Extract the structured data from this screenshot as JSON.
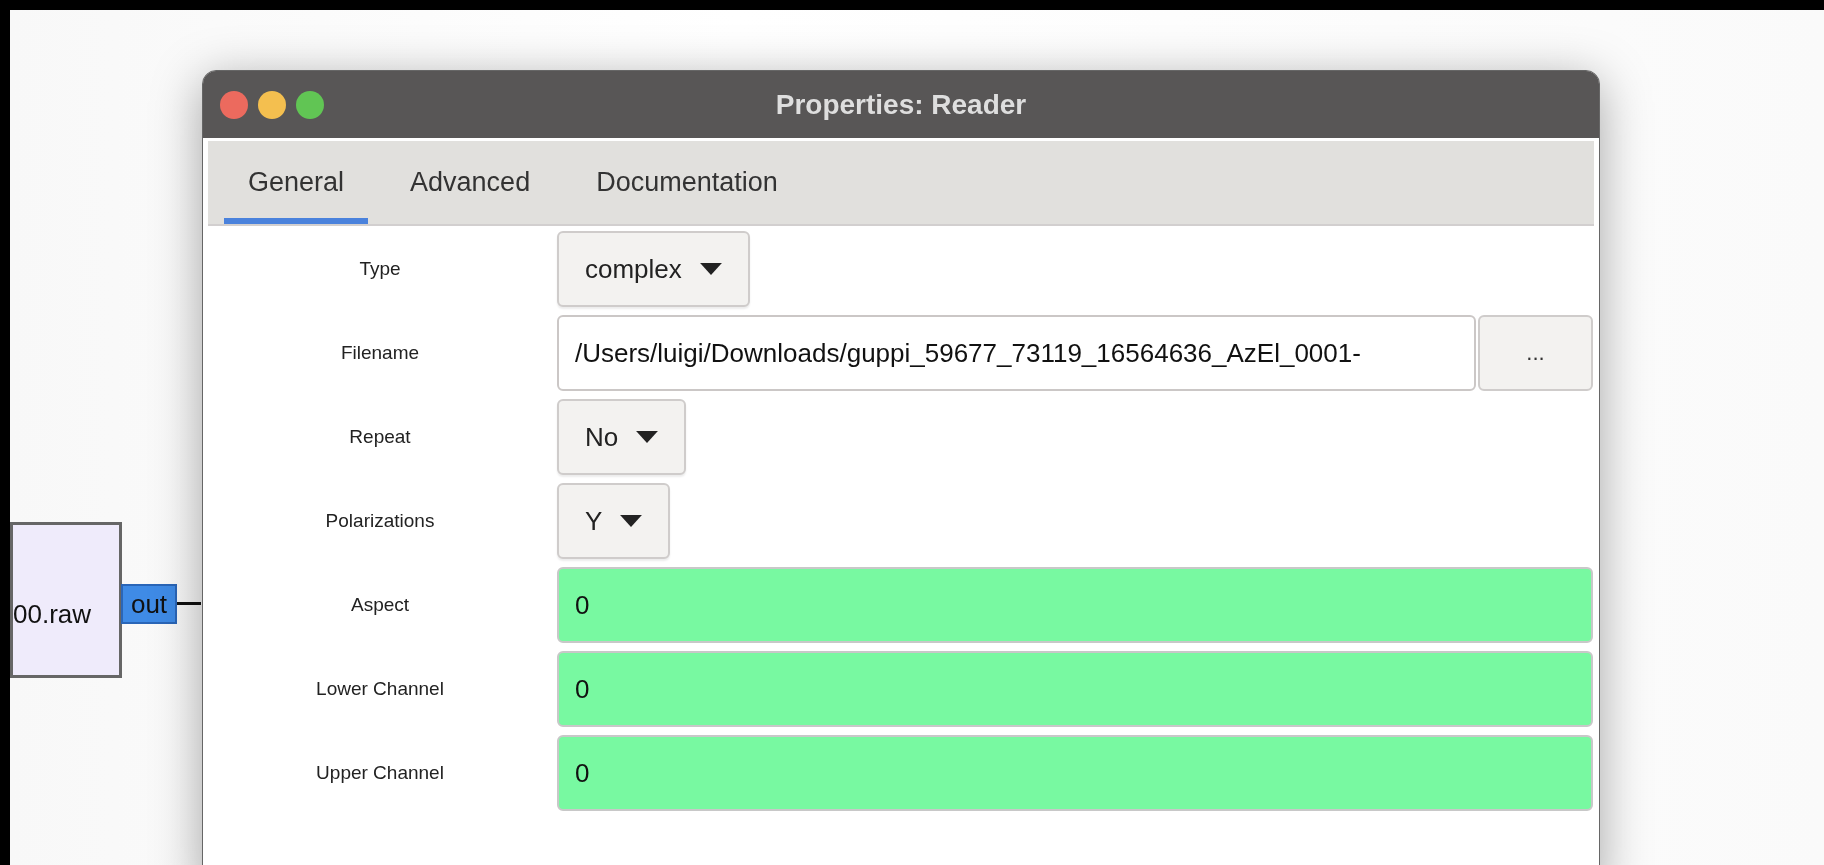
{
  "canvas": {
    "block": {
      "label": "00.raw",
      "port": "out"
    }
  },
  "window": {
    "title": "Properties: Reader"
  },
  "tabs": [
    {
      "label": "General",
      "selected": true
    },
    {
      "label": "Advanced",
      "selected": false
    },
    {
      "label": "Documentation",
      "selected": false
    }
  ],
  "fields": [
    {
      "label": "Type",
      "kind": "dropdown",
      "value": "complex"
    },
    {
      "label": "Filename",
      "kind": "file",
      "value": "/Users/luigi/Downloads/guppi_59677_73119_16564636_AzEl_0001-",
      "button": "..."
    },
    {
      "label": "Repeat",
      "kind": "dropdown",
      "value": "No"
    },
    {
      "label": "Polarizations",
      "kind": "dropdown",
      "value": "Y"
    },
    {
      "label": "Aspect",
      "kind": "number",
      "value": "0"
    },
    {
      "label": "Lower Channel",
      "kind": "number",
      "value": "0"
    },
    {
      "label": "Upper Channel",
      "kind": "number",
      "value": "0"
    }
  ]
}
